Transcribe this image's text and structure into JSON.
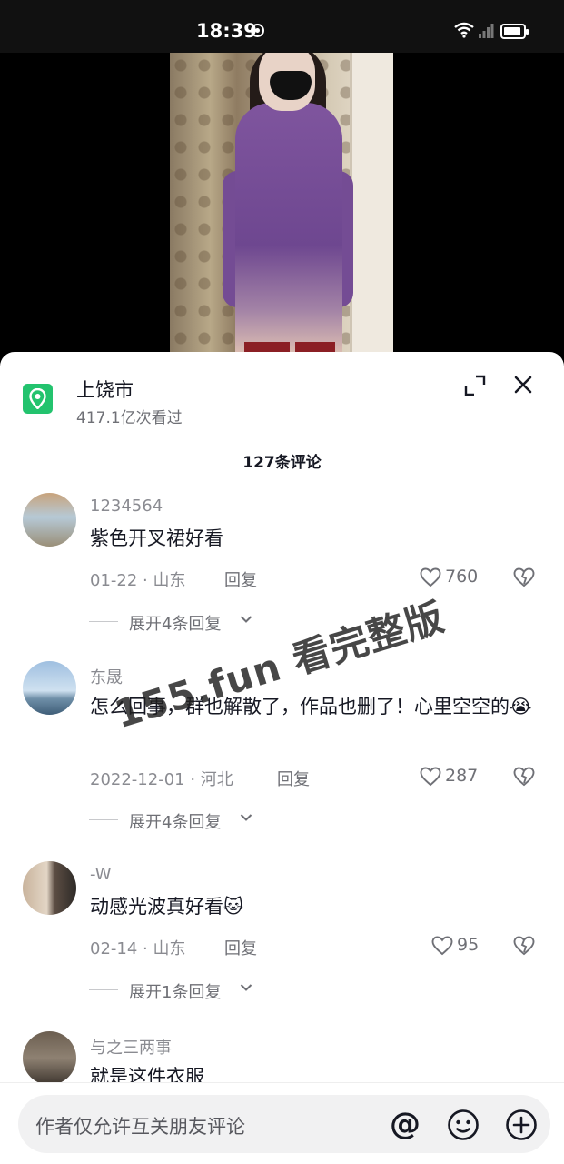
{
  "status_bar": {
    "time": "18:39"
  },
  "location": {
    "name": "上饶市",
    "views": "417.1亿次看过"
  },
  "comments_header": {
    "count_label": "127条评论"
  },
  "comments": [
    {
      "user": "1234564",
      "text": "紫色开叉裙好看",
      "meta": "01-22 · 山东",
      "reply_label": "回复",
      "likes": "760",
      "expand_label": "展开4条回复"
    },
    {
      "user": "东晟",
      "text": "怎么回事，群也解散了，作品也删了！心里空空的😭",
      "meta": "2022-12-01 · 河北",
      "reply_label": "回复",
      "likes": "287",
      "expand_label": "展开4条回复"
    },
    {
      "user": "-W",
      "text": "动感光波真好看🐱",
      "meta": "02-14 · 山东",
      "reply_label": "回复",
      "likes": "95",
      "expand_label": "展开1条回复"
    },
    {
      "user": "与之三两事",
      "text": "就是这件衣服",
      "meta": "",
      "reply_label": "",
      "likes": "",
      "expand_label": ""
    }
  ],
  "watermark": "155.fun 看完整版",
  "input": {
    "placeholder": "作者仅允许互关朋友评论"
  },
  "colors": {
    "location_green": "#23c36e",
    "text_primary": "#161823",
    "text_secondary": "#8a8b91"
  },
  "icons": [
    "location-pin-icon",
    "expand-icon",
    "close-icon",
    "heart-icon",
    "dislike-heart-icon",
    "chevron-down-icon",
    "at-icon",
    "emoji-icon",
    "add-icon"
  ]
}
